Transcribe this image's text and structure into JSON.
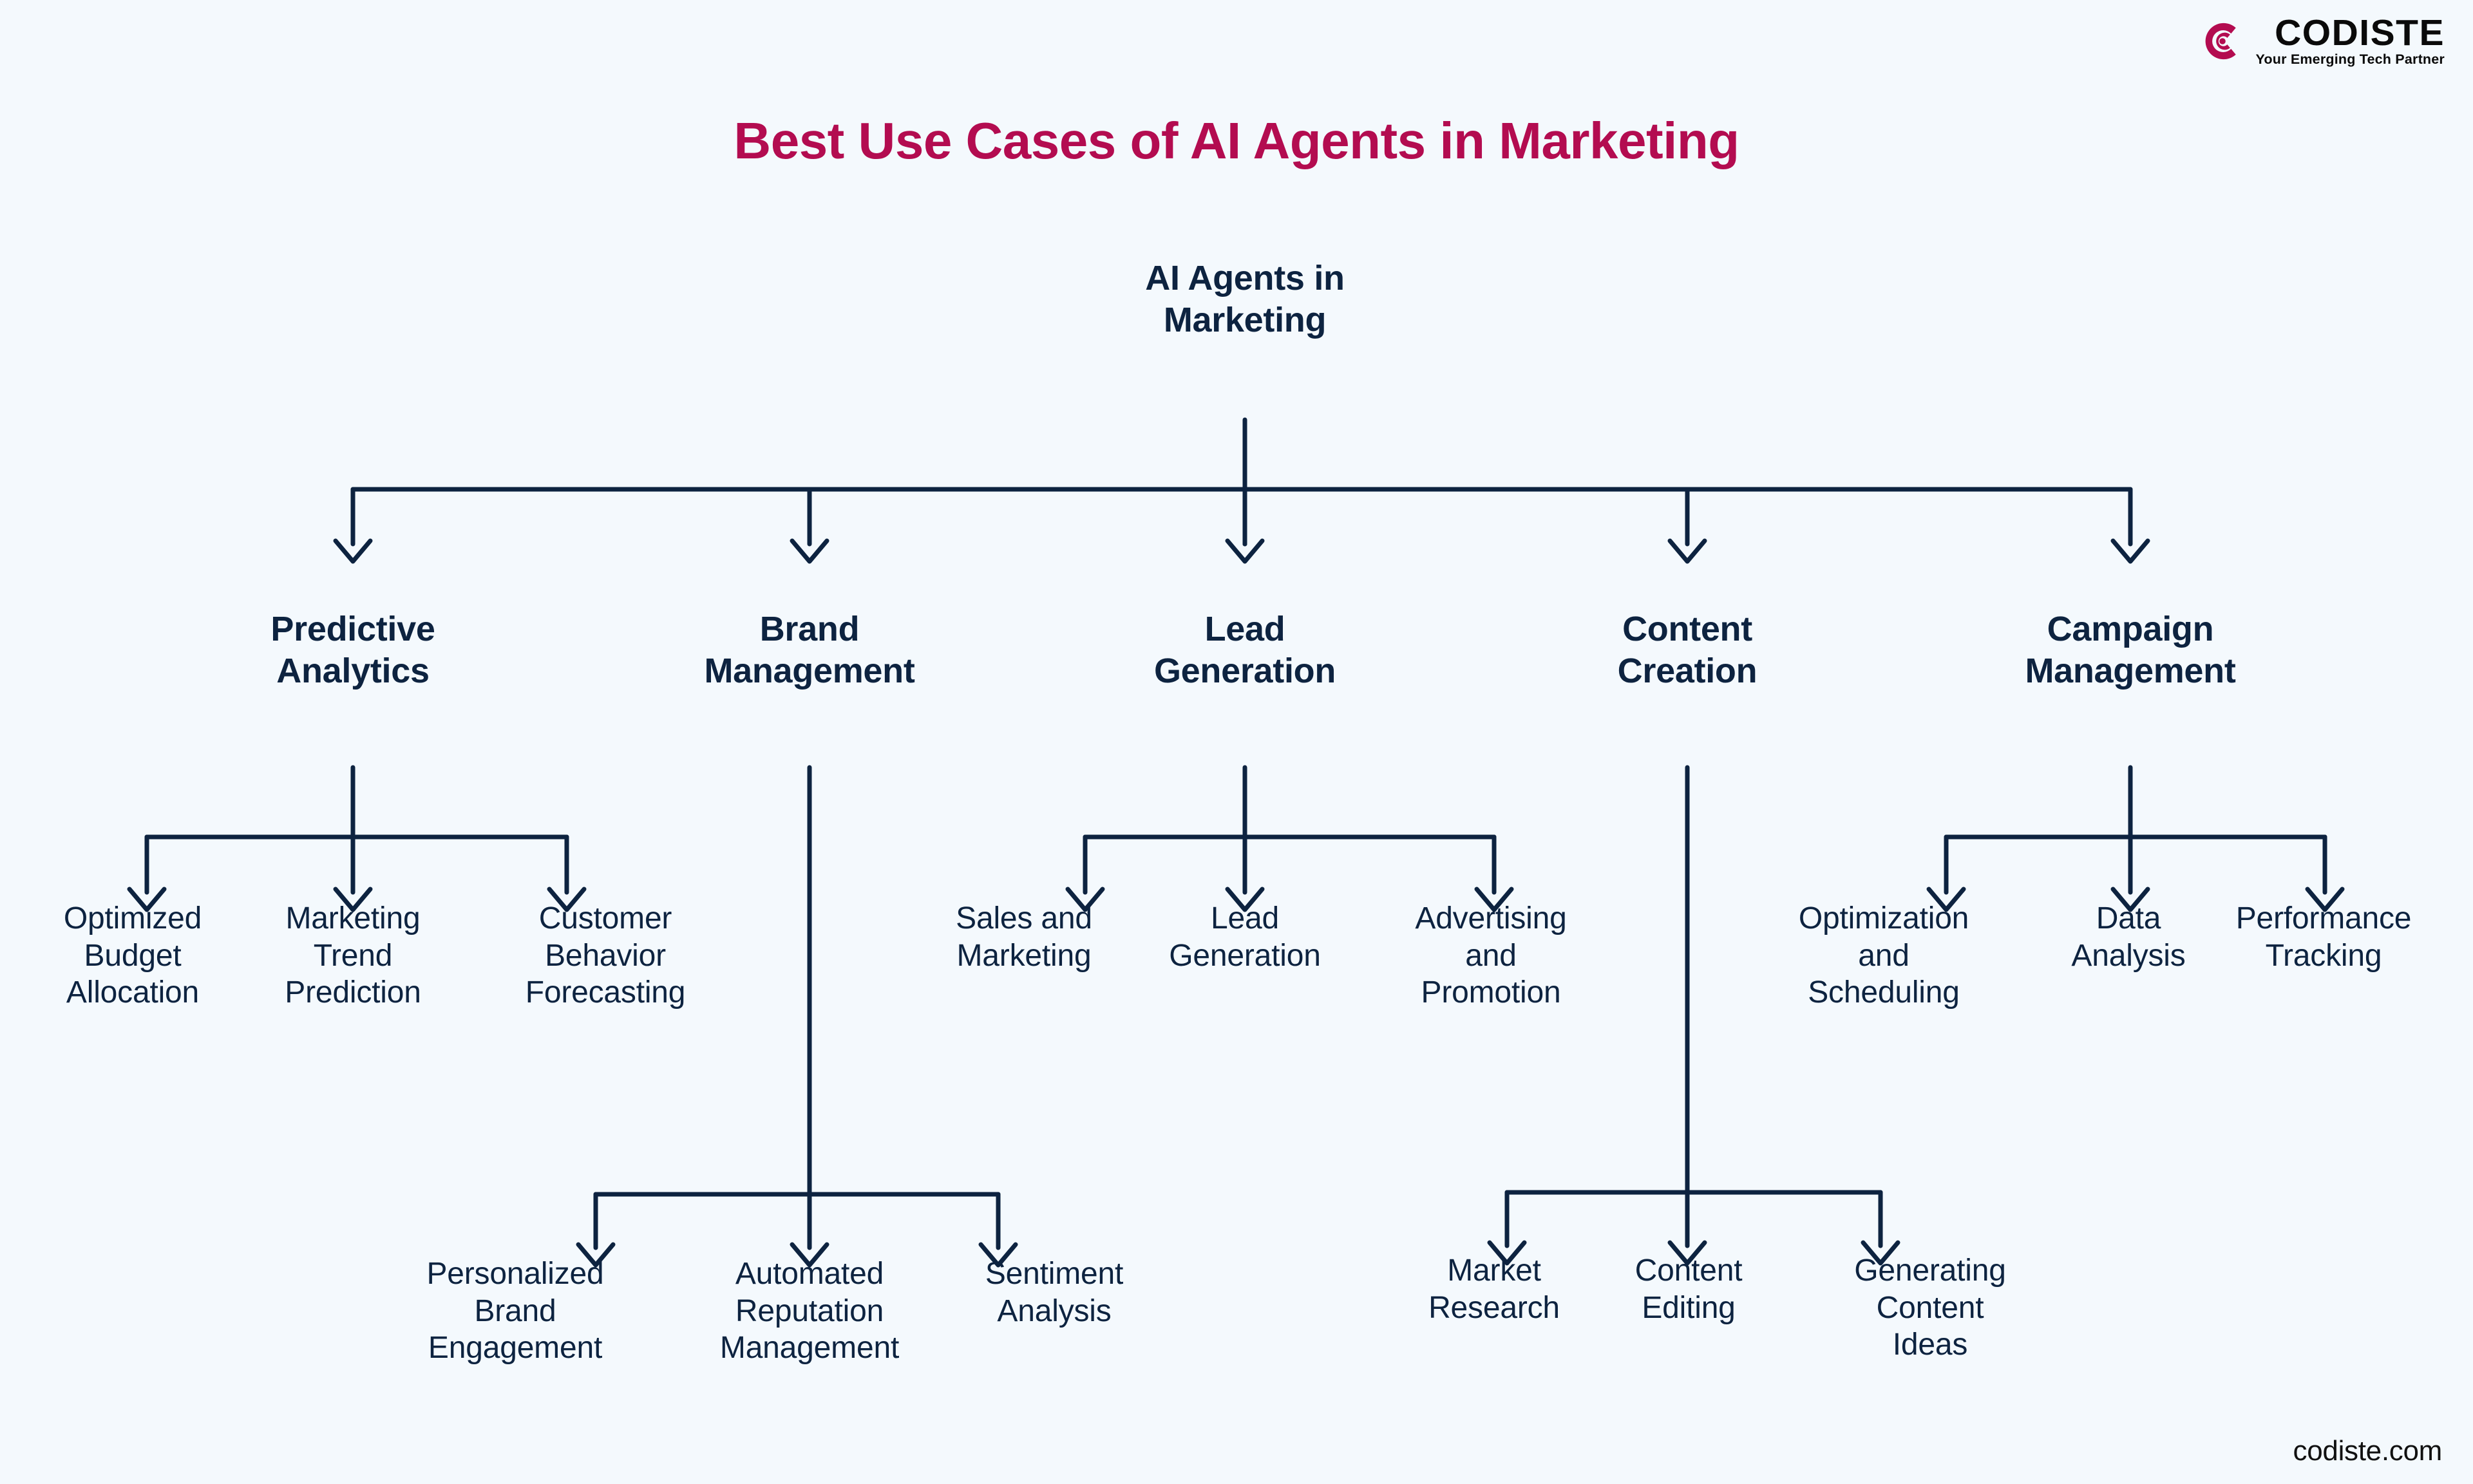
{
  "brand": {
    "logo_icon": "codiste-circular-c-mark",
    "wordmark": "CODISTE",
    "tagline": "Your Emerging Tech Partner",
    "mark_color": "#b30c50"
  },
  "page": {
    "title": "Best Use Cases of AI Agents in Marketing",
    "title_color": "#b30c50",
    "background_color": "#f4f9fd",
    "node_color": "#0d2340",
    "connector_color": "#0d2340"
  },
  "footer": {
    "url": "codiste.com"
  },
  "chart_data": {
    "type": "diagram",
    "diagram_type": "tree",
    "title": "Best Use Cases of AI Agents in Marketing",
    "root": "AI Agents in Marketing",
    "orientation": "top-down",
    "levels": 3,
    "branch_count": 5,
    "leaf_count": 15,
    "branches": [
      {
        "label": "Predictive Analytics",
        "children": [
          "Optimized Budget Allocation",
          "Marketing Trend Prediction",
          "Customer Behavior Forecasting"
        ]
      },
      {
        "label": "Brand Management",
        "children": [
          "Personalized Brand Engagement",
          "Automated Reputation Management",
          "Sentiment Analysis"
        ]
      },
      {
        "label": "Lead Generation",
        "children": [
          "Sales and Marketing",
          "Lead Generation",
          "Advertising and Promotion"
        ]
      },
      {
        "label": "Content Creation",
        "children": [
          "Market Research",
          "Content Editing",
          "Generating Content Ideas"
        ]
      },
      {
        "label": "Campaign Management",
        "children": [
          "Optimization and Scheduling",
          "Data Analysis",
          "Performance Tracking"
        ]
      }
    ]
  },
  "nodes": {
    "root": "AI Agents in\nMarketing",
    "branch_0": "Predictive\nAnalytics",
    "branch_1": "Brand\nManagement",
    "branch_2": "Lead\nGeneration",
    "branch_3": "Content\nCreation",
    "branch_4": "Campaign\nManagement",
    "leaf_0_0": "Optimized\nBudget\nAllocation",
    "leaf_0_1": "Marketing\nTrend\nPrediction",
    "leaf_0_2": "Customer\nBehavior\nForecasting",
    "leaf_1_0": "Personalized\nBrand\nEngagement",
    "leaf_1_1": "Automated\nReputation\nManagement",
    "leaf_1_2": "Sentiment\nAnalysis",
    "leaf_2_0": "Sales and\nMarketing",
    "leaf_2_1": "Lead\nGeneration",
    "leaf_2_2": "Advertising\nand\nPromotion",
    "leaf_3_0": "Market\nResearch",
    "leaf_3_1": "Content\nEditing",
    "leaf_3_2": "Generating\nContent\nIdeas",
    "leaf_4_0": "Optimization\nand\nScheduling",
    "leaf_4_1": "Data\nAnalysis",
    "leaf_4_2": "Performance\nTracking"
  }
}
